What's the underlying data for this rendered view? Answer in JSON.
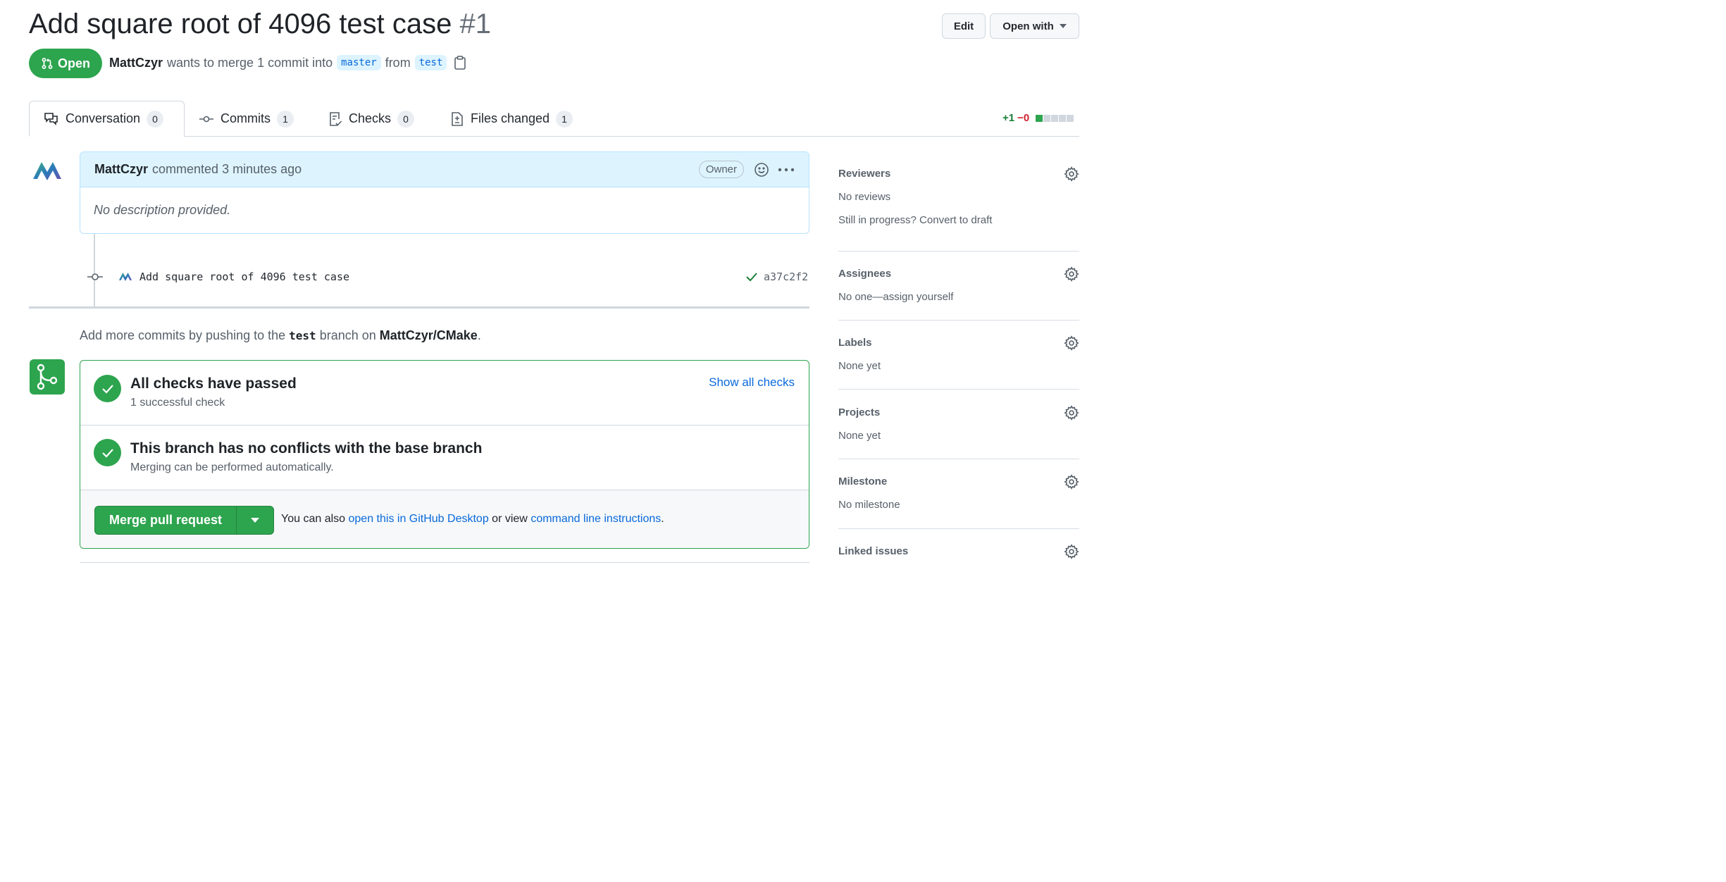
{
  "header": {
    "title": "Add square root of 4096 test case",
    "number": "#1",
    "edit_label": "Edit",
    "open_with_label": "Open with",
    "state": "Open",
    "author": "MattCzyr",
    "merge_text": "wants to merge 1 commit into",
    "base_branch": "master",
    "from_text": "from",
    "head_branch": "test"
  },
  "tabs": [
    {
      "label": "Conversation",
      "count": "0",
      "icon": "comment-discussion-icon",
      "active": true
    },
    {
      "label": "Commits",
      "count": "1",
      "icon": "git-commit-icon"
    },
    {
      "label": "Checks",
      "count": "0",
      "icon": "checklist-icon"
    },
    {
      "label": "Files changed",
      "count": "1",
      "icon": "file-diff-icon"
    }
  ],
  "diffstat": {
    "additions": "+1",
    "deletions": "−0",
    "colors": [
      "#2da44e",
      "#d0d7de",
      "#d0d7de",
      "#d0d7de",
      "#d0d7de"
    ]
  },
  "comment": {
    "author": "MattCzyr",
    "action": "commented",
    "time": "3 minutes ago",
    "role_badge": "Owner",
    "body": "No description provided."
  },
  "commit": {
    "message": "Add square root of 4096 test case",
    "sha": "a37c2f2"
  },
  "push_hint": {
    "prefix": "Add more commits by pushing to the",
    "branch": "test",
    "middle": "branch on",
    "repo": "MattCzyr/CMake",
    "suffix": "."
  },
  "merge": {
    "checks_title": "All checks have passed",
    "checks_sub": "1 successful check",
    "show_checks": "Show all checks",
    "conflicts_title": "This branch has no conflicts with the base branch",
    "conflicts_sub": "Merging can be performed automatically.",
    "merge_button": "Merge pull request",
    "note_prefix": "You can also",
    "desktop_link": "open this in GitHub Desktop",
    "note_middle": "or view",
    "cli_link": "command line instructions",
    "note_suffix": "."
  },
  "sidebar": {
    "reviewers": {
      "title": "Reviewers",
      "line1": "No reviews",
      "line2": "Still in progress? Convert to draft"
    },
    "assignees": {
      "title": "Assignees",
      "line1": "No one—assign yourself"
    },
    "labels": {
      "title": "Labels",
      "line1": "None yet"
    },
    "projects": {
      "title": "Projects",
      "line1": "None yet"
    },
    "milestone": {
      "title": "Milestone",
      "line1": "No milestone"
    },
    "linked_issues": {
      "title": "Linked issues"
    }
  },
  "colors": {
    "green": "#2da44e",
    "link": "#0969da",
    "muted": "#57606a"
  }
}
